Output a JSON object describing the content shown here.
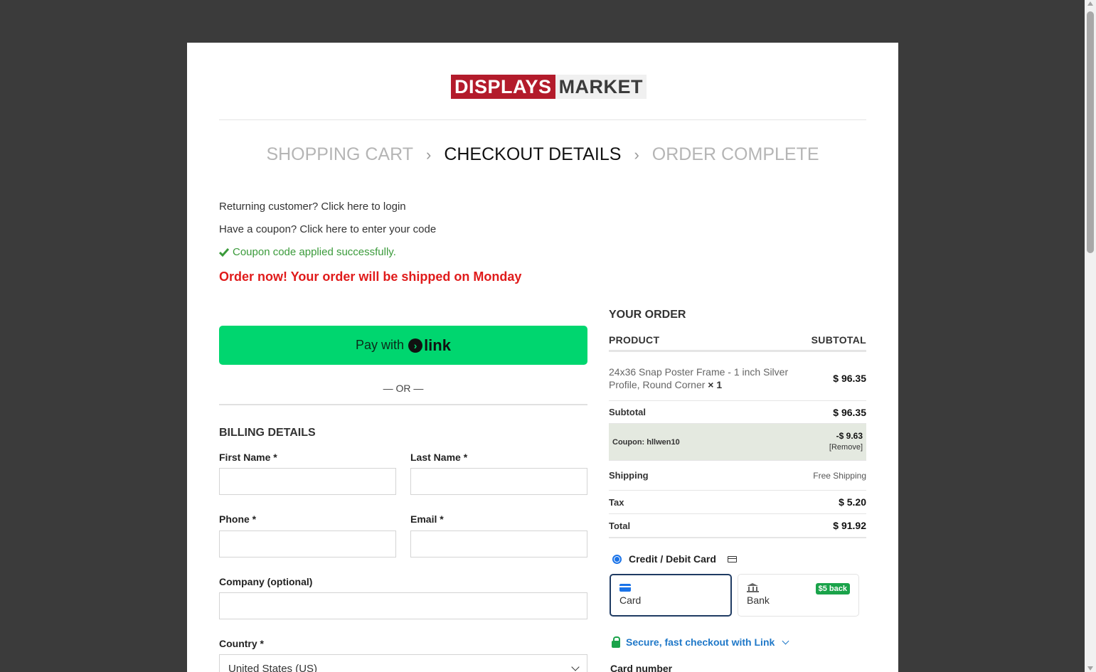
{
  "brand": {
    "part1": "DISPLAYS",
    "part2": "MARKET"
  },
  "steps": [
    "SHOPPING CART",
    "CHECKOUT DETAILS",
    "ORDER COMPLETE"
  ],
  "notices": {
    "returning": "Returning customer? Click here to login",
    "coupon": "Have a coupon? Click here to enter your code",
    "coupon_ok": "Coupon code applied successfully.",
    "ship_msg": "Order now! Your order will be shipped on Monday"
  },
  "link_pay": {
    "prefix": "Pay with",
    "brand": "link"
  },
  "or_text": "— OR —",
  "billing": {
    "title": "BILLING DETAILS",
    "first_name": "First Name *",
    "last_name": "Last Name *",
    "phone": "Phone *",
    "email": "Email *",
    "company": "Company (optional)",
    "country": "Country *",
    "country_value": "United States (US)"
  },
  "order": {
    "title": "YOUR ORDER",
    "col_product": "PRODUCT",
    "col_subtotal": "SUBTOTAL",
    "item_name": "24x36 Snap Poster Frame - 1 inch Silver Profile, Round Corner",
    "item_qty": "× 1",
    "item_price": "$ 96.35",
    "subtotal_label": "Subtotal",
    "subtotal_value": "$ 96.35",
    "coupon_label": "Coupon: hllwen10",
    "coupon_value": "-$ 9.63",
    "coupon_remove": "[Remove]",
    "shipping_label": "Shipping",
    "shipping_value": "Free Shipping",
    "tax_label": "Tax",
    "tax_value": "$ 5.20",
    "total_label": "Total",
    "total_value": "$ 91.92"
  },
  "payment": {
    "method_label": "Credit / Debit Card",
    "tab_card": "Card",
    "tab_bank": "Bank",
    "bank_badge": "$5 back",
    "secure_text": "Secure, fast checkout with Link",
    "card_number_label": "Card number"
  },
  "colors": {
    "brand_red": "#b31b2b",
    "link_green": "#00d66f",
    "notice_red": "#e01b1b",
    "success_green": "#3a9a3a"
  }
}
